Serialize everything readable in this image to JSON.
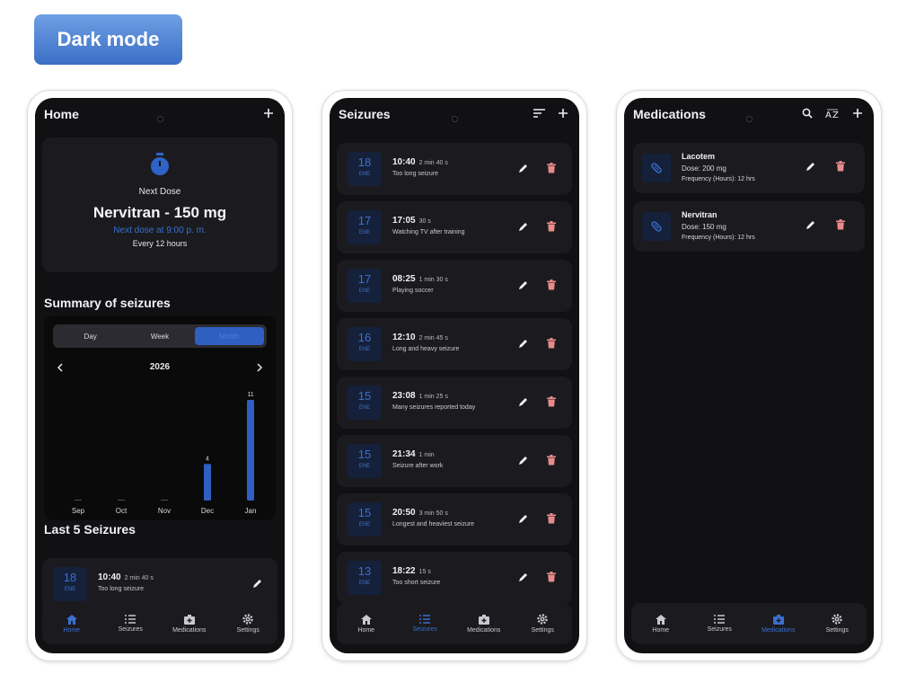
{
  "badge": "Dark mode",
  "colors": {
    "accent": "#3b6fd0",
    "danger": "#e88a8a",
    "background": "#111113",
    "card": "#1b1b1f"
  },
  "home": {
    "title": "Home",
    "next_dose_label": "Next Dose",
    "medication": "Nervitran - 150 mg",
    "next_dose_time": "Next dose at 9:00 p. m.",
    "frequency": "Every 12 hours",
    "summary_title": "Summary of seizures",
    "segments": [
      "Day",
      "Week",
      "Month"
    ],
    "active_segment": "Month",
    "year": "2026",
    "last5_title": "Last 5 Seizures",
    "last_item": {
      "day": "18",
      "month": "ENE",
      "time": "10:40",
      "duration": "2 min 40 s",
      "desc": "Too long seizure"
    }
  },
  "chart_data": {
    "type": "bar",
    "categories": [
      "Sep",
      "Oct",
      "Nov",
      "Dec",
      "Jan"
    ],
    "values": [
      0,
      0,
      0,
      4,
      11
    ],
    "data_labels": [
      "",
      "",
      "",
      "4",
      "11"
    ],
    "ylim": [
      0,
      11
    ]
  },
  "seizures": {
    "title": "Seizures",
    "items": [
      {
        "day": "18",
        "month": "ENE",
        "time": "10:40",
        "duration": "2 min 40 s",
        "desc": "Too long seizure"
      },
      {
        "day": "17",
        "month": "ENE",
        "time": "17:05",
        "duration": "30 s",
        "desc": "Watching TV after training"
      },
      {
        "day": "17",
        "month": "ENE",
        "time": "08:25",
        "duration": "1 min 30 s",
        "desc": "Playing soccer"
      },
      {
        "day": "16",
        "month": "ENE",
        "time": "12:10",
        "duration": "2 min 45 s",
        "desc": "Long and heavy seizure"
      },
      {
        "day": "15",
        "month": "ENE",
        "time": "23:08",
        "duration": "1 min 25 s",
        "desc": "Many seizures reported today"
      },
      {
        "day": "15",
        "month": "ENE",
        "time": "21:34",
        "duration": "1 min",
        "desc": "Seizure after work"
      },
      {
        "day": "15",
        "month": "ENE",
        "time": "20:50",
        "duration": "3 min 50 s",
        "desc": "Longest and heaviest seizure"
      },
      {
        "day": "13",
        "month": "ENE",
        "time": "18:22",
        "duration": "15 s",
        "desc": "Too short seizure"
      }
    ]
  },
  "medications": {
    "title": "Medications",
    "items": [
      {
        "name": "Lacotem",
        "dose": "Dose: 200 mg",
        "freq": "Frequency (Hours): 12 hrs"
      },
      {
        "name": "Nervitran",
        "dose": "Dose: 150 mg",
        "freq": "Frequency (Hours): 12 hrs"
      }
    ]
  },
  "nav": {
    "home": "Home",
    "seizures": "Seizures",
    "medications": "Medications",
    "settings": "Settings"
  },
  "icons": [
    "timer-icon",
    "add-icon",
    "sort-icon",
    "search-icon",
    "sort-az-icon",
    "edit-icon",
    "delete-icon",
    "pill-icon",
    "home-icon",
    "list-icon",
    "medical-bag-icon",
    "gear-icon",
    "chevron-left-icon",
    "chevron-right-icon"
  ]
}
